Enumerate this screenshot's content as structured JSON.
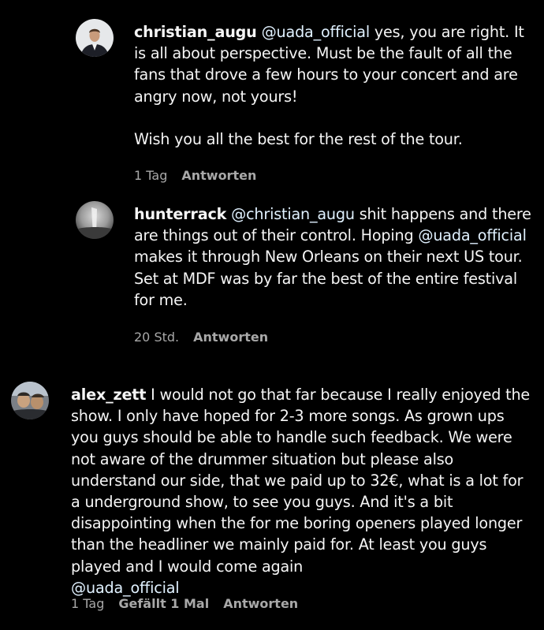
{
  "comments": [
    {
      "username": "christian_augu",
      "mention": "@uada_official",
      "text_after_mention": " yes, you are right. It is all about perspective. Must be the fault of all the fans that drove a few hours to your concert and are angry now, not yours!\n\nWish you all the best for the rest of the tour.",
      "time": "1 Tag",
      "reply_label": "Antworten"
    },
    {
      "username": "hunterrack",
      "mention": "@christian_augu",
      "text_middle": " shit happens and there are things out of their control. Hoping ",
      "mention2": "@uada_official",
      "text_after_mention2": "\nmakes it through New Orleans on their next US tour. Set at MDF was by far the best of the entire festival for me.",
      "time": "20 Std.",
      "reply_label": "Antworten"
    },
    {
      "username": "alex_zett",
      "text_after_username": " I would not go that far because I really enjoyed the show. I only have hoped for 2-3 more songs. As grown ups you guys should be able to handle such feedback. We were not aware of the drummer situation but please also understand our side, that we paid up to 32€, what is a lot for a underground show, to see you guys. And it's a bit disappointing when the for me boring openers played longer than the headliner we mainly paid for. At least you guys played and I would come again\n",
      "mention": "@uada_official",
      "time": "1 Tag",
      "likes": "Gefällt 1 Mal",
      "reply_label": "Antworten"
    }
  ],
  "colors": {
    "background": "#000000",
    "text": "#f5f5f5",
    "mention": "#e0f1ff",
    "meta": "#a8a8a8"
  }
}
